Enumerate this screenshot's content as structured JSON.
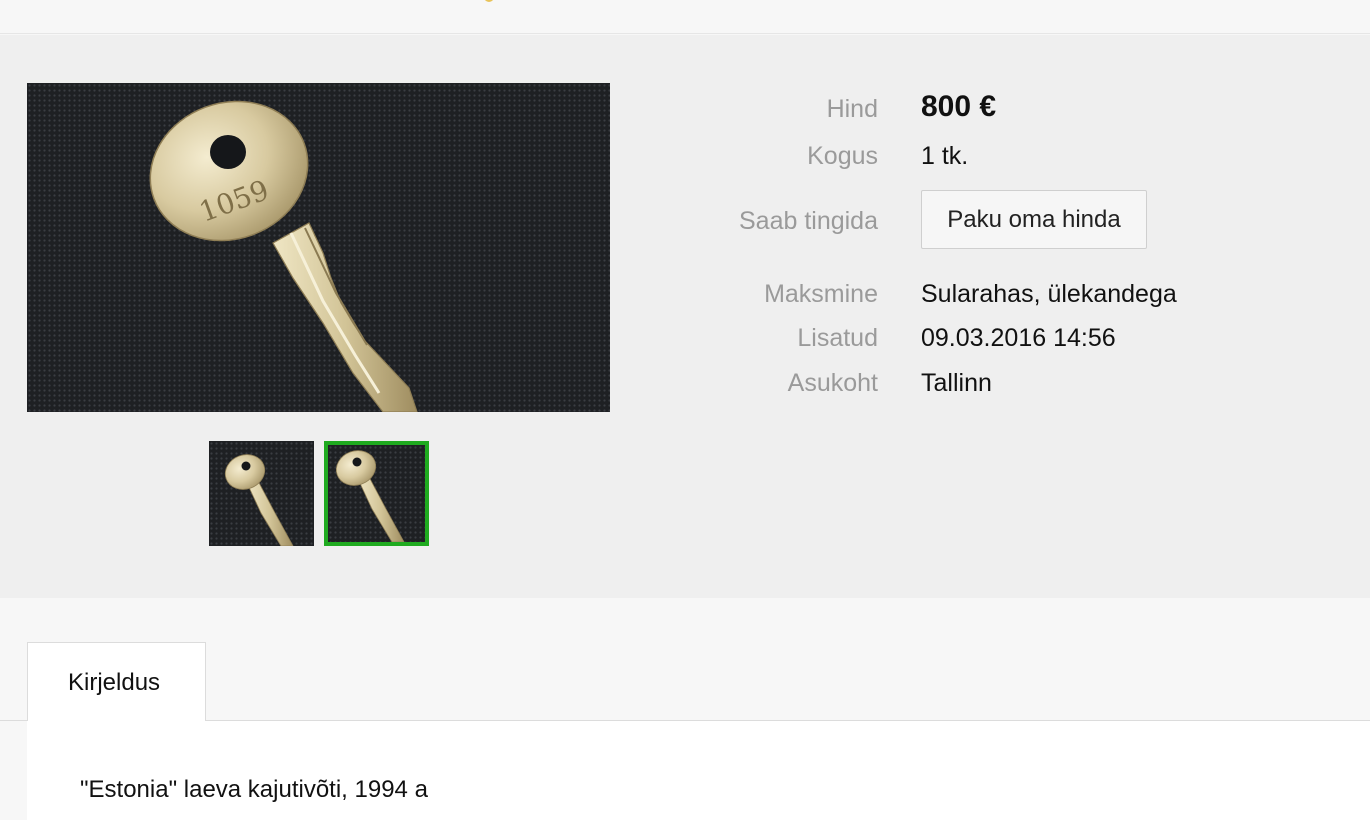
{
  "listing": {
    "images": {
      "main": "key-photo",
      "thumbnails": [
        "key-photo",
        "key-photo"
      ],
      "selected_index": 1,
      "key_number": "1059"
    },
    "details": {
      "price_label": "Hind",
      "price_value": "800 €",
      "quantity_label": "Kogus",
      "quantity_value": "1 tk.",
      "negotiable_label": "Saab tingida",
      "offer_button_label": "Paku oma hinda",
      "payment_label": "Maksmine",
      "payment_value": "Sularahas, ülekandega",
      "added_label": "Lisatud",
      "added_value": "09.03.2016 14:56",
      "location_label": "Asukoht",
      "location_value": "Tallinn"
    },
    "tabs": [
      {
        "label": "Kirjeldus",
        "active": true
      }
    ],
    "description": "\"Estonia\" laeva kajutivõti, 1994 a"
  },
  "colors": {
    "panel_bg": "#efefef",
    "label_text": "#9a9a9a",
    "selected_thumb_border": "#1faa1f",
    "photo_bg": "#1d1f22",
    "key_metal": "#d9cc9e"
  }
}
